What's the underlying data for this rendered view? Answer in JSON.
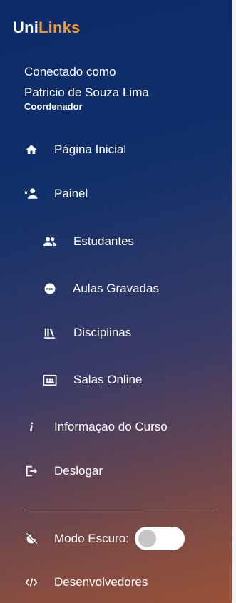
{
  "brand": {
    "part1": "Uni",
    "part2": "Links"
  },
  "user": {
    "connected_label": "Conectado como",
    "name": "Patricio de Souza Lima",
    "role": "Coordenador"
  },
  "nav": {
    "home": "Página Inicial",
    "panel": "Painel",
    "students": "Estudantes",
    "recorded_classes": "Aulas Gravadas",
    "subjects": "Disciplinas",
    "online_rooms": "Salas Online",
    "course_info": "Informaçao do Curso",
    "logout": "Deslogar"
  },
  "settings": {
    "dark_mode_label": "Modo Escuro:",
    "dark_mode_on": false,
    "developers": "Desenvolvedores"
  },
  "colors": {
    "brand_accent": "#f39a2e",
    "gradient_top": "#0b2a68",
    "gradient_bottom": "#9a5238"
  }
}
